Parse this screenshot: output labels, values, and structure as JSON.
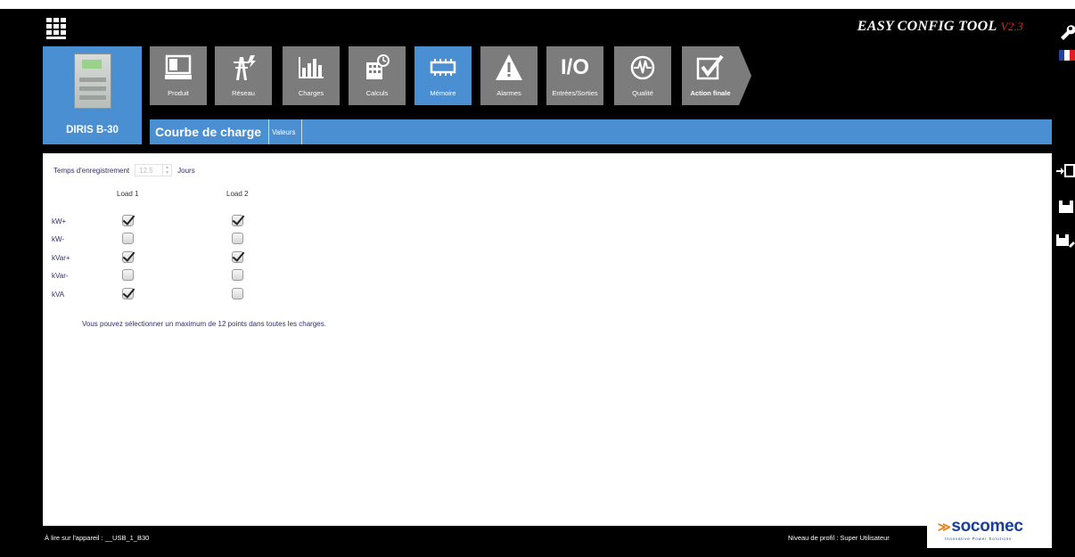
{
  "header": {
    "menu_icon": "grid-menu-icon",
    "app_title": "EASY CONFIG TOOL",
    "version": "V2.3"
  },
  "side_icons": [
    "wrench-icon",
    "flag-fr-icon",
    "send-to-device-icon",
    "save-icon",
    "save-as-icon"
  ],
  "device": {
    "name": "DIRIS B-30",
    "image": "device-module-image"
  },
  "nav": {
    "items": [
      {
        "label": "Produit",
        "icon": "monitor-icon"
      },
      {
        "label": "Réseau",
        "icon": "pylon-icon"
      },
      {
        "label": "Charges",
        "icon": "bar-chart-icon"
      },
      {
        "label": "Calculs",
        "icon": "calculator-icon"
      },
      {
        "label": "Mémoire",
        "icon": "memory-chip-icon"
      },
      {
        "label": "Alarmes",
        "icon": "warning-icon"
      },
      {
        "label": "Entrées/Sorties",
        "icon": "io-icon"
      },
      {
        "label": "Qualité",
        "icon": "waveform-icon"
      },
      {
        "label": "Action finale",
        "icon": "checkmark-icon"
      }
    ],
    "active_index": 4
  },
  "tabs": {
    "courbe": "Courbe de charge",
    "valeurs": "Valeurs"
  },
  "recording": {
    "label": "Temps d'enregistrement",
    "value": "12.5",
    "unit": "Jours"
  },
  "loads": {
    "columns": [
      "Load 1",
      "Load 2"
    ],
    "rows": [
      {
        "label": "kW+",
        "load1": true,
        "load2": true
      },
      {
        "label": "kW-",
        "load1": false,
        "load2": false
      },
      {
        "label": "kVar+",
        "load1": true,
        "load2": true
      },
      {
        "label": "kVar-",
        "load1": false,
        "load2": false
      },
      {
        "label": "kVA",
        "load1": true,
        "load2": false
      }
    ]
  },
  "note": "Vous pouvez sélectionner un maximum de 12 points dans toutes les charges.",
  "footer": {
    "read_device": "À lire sur l'appareil : __USB_1_B30",
    "profile": "Niveau de profil : Super Utilisateur"
  },
  "brand": {
    "name": "socomec",
    "tagline": "Innovative Power Solutions"
  },
  "colors": {
    "accent_blue": "#4a8fd2",
    "tile_gray": "#7c7c7c",
    "version_red": "#e0261b",
    "brand_blue": "#1b3f93",
    "brand_orange": "#e4811b"
  }
}
